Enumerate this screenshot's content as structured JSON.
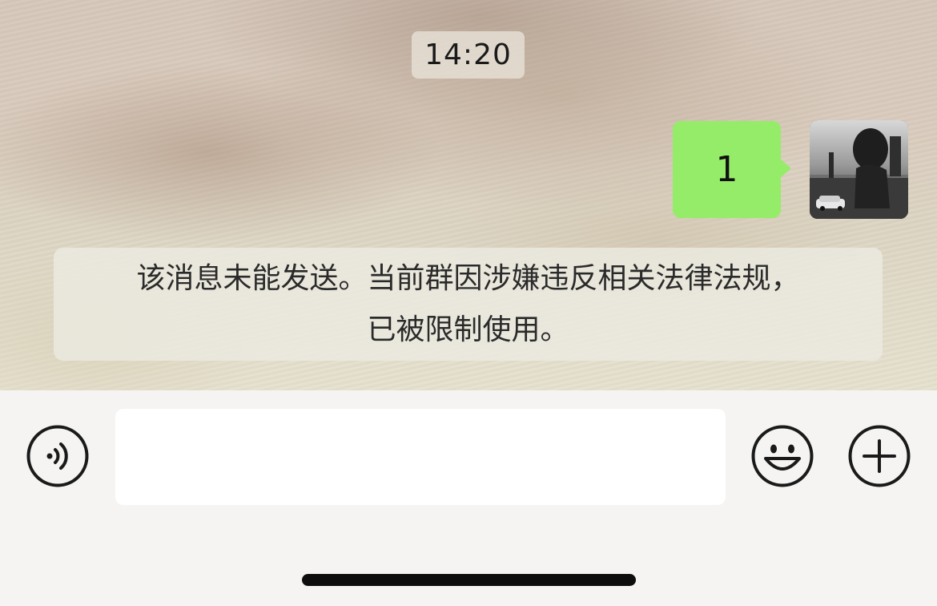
{
  "chat": {
    "timestamp": "14:20",
    "sent_message": "1",
    "system_notice_line1": "该消息未能发送。当前群因涉嫌违反相关法律法规，",
    "system_notice_line2": "已被限制使用。"
  },
  "input_bar": {
    "text_value": "",
    "icons": [
      "voice-icon",
      "emoji-icon",
      "plus-icon"
    ]
  },
  "colors": {
    "sent_bubble": "#95ec69",
    "input_bar_bg": "#f5f4f2"
  }
}
